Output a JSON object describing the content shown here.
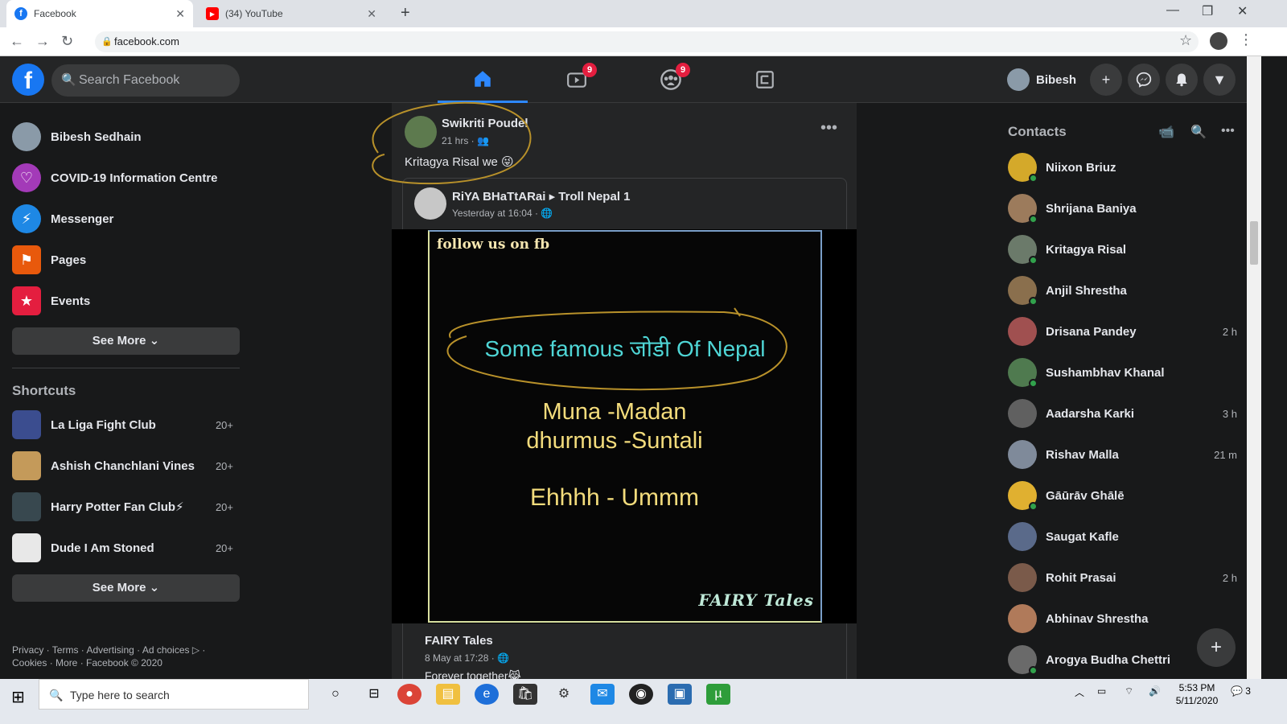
{
  "browser": {
    "tabs": [
      {
        "title": "Facebook",
        "icon": "facebook-favicon",
        "color": "#1877f2"
      },
      {
        "title": "(34) YouTube",
        "icon": "youtube-favicon",
        "color": "#ff0000"
      }
    ],
    "url": "facebook.com"
  },
  "header": {
    "search_placeholder": "Search Facebook",
    "nav": [
      {
        "icon": "home-icon",
        "badge": ""
      },
      {
        "icon": "watch-icon",
        "badge": "9"
      },
      {
        "icon": "groups-icon",
        "badge": "9"
      },
      {
        "icon": "gaming-icon",
        "badge": ""
      }
    ],
    "profile_name": "Bibesh",
    "accent": "#2d88ff"
  },
  "left_sidebar": {
    "items": [
      {
        "label": "Bibesh Sedhain",
        "icon": "profile-avatar",
        "color": "#8a9aa8"
      },
      {
        "label": "COVID-19 Information Centre",
        "icon": "covid-heart-icon",
        "color": "#a33ab8"
      },
      {
        "label": "Messenger",
        "icon": "messenger-icon",
        "color": "#1e88e5"
      },
      {
        "label": "Pages",
        "icon": "pages-flag-icon",
        "color": "#e8590c"
      },
      {
        "label": "Events",
        "icon": "events-calendar-icon",
        "color": "#e41e3f"
      }
    ],
    "see_more_1": "See More",
    "shortcuts_title": "Shortcuts",
    "shortcuts": [
      {
        "label": "La Liga Fight Club",
        "count": "20+",
        "color": "#3b4d8f"
      },
      {
        "label": "Ashish Chanchlani Vines",
        "count": "20+",
        "color": "#c49a5a"
      },
      {
        "label": "Harry Potter Fan Club⚡",
        "count": "20+",
        "color": "#38484f"
      },
      {
        "label": "Dude I Am Stoned",
        "count": "20+",
        "color": "#e8e8e8"
      }
    ],
    "see_more_2": "See More",
    "footer_line1": "Privacy · Terms · Advertising · Ad choices ▷ ·",
    "footer_line2": "Cookies · More · Facebook © 2020"
  },
  "post": {
    "author": "Swikriti Poudel",
    "time": "21 hrs ·",
    "text": "Kritagya Risal we 😜",
    "shared": {
      "author": "RiYA BHaTtARai",
      "target": "Troll Nepal 1",
      "time": "Yesterday at 16:04 ·"
    },
    "image": {
      "follow": "follow us on fb",
      "title": "Some famous जोडी Of Nepal",
      "line1": "Muna -Madan",
      "line2": "dhurmus -Suntali",
      "line3": "Ehhhh - Ummm",
      "signature": "FAIRY Tales"
    },
    "footer": {
      "name": "FAIRY Tales",
      "time": "8 May at 17:28 ·",
      "text": "Forever together😹"
    }
  },
  "contacts": {
    "title": "Contacts",
    "list": [
      {
        "name": "Niixon Briuz",
        "time": "",
        "online": true,
        "color": "#d4a92a"
      },
      {
        "name": "Shrijana Baniya",
        "time": "",
        "online": true,
        "color": "#9c7b5c"
      },
      {
        "name": "Kritagya Risal",
        "time": "",
        "online": true,
        "color": "#6b7a6a"
      },
      {
        "name": "Anjil Shrestha",
        "time": "",
        "online": true,
        "color": "#8a6f4d"
      },
      {
        "name": "Drisana Pandey",
        "time": "2 h",
        "online": false,
        "color": "#a05050"
      },
      {
        "name": "Sushambhav Khanal",
        "time": "",
        "online": true,
        "color": "#4f7a4f"
      },
      {
        "name": "Aadarsha Karki",
        "time": "3 h",
        "online": false,
        "color": "#606060"
      },
      {
        "name": "Rishav Malla",
        "time": "21 m",
        "online": false,
        "color": "#7f8a9a"
      },
      {
        "name": "Gāūrāv Ghālē",
        "time": "",
        "online": true,
        "color": "#e0b030"
      },
      {
        "name": "Saugat Kafle",
        "time": "",
        "online": false,
        "color": "#5a6a8a"
      },
      {
        "name": "Rohit Prasai",
        "time": "2 h",
        "online": false,
        "color": "#7a5a4a"
      },
      {
        "name": "Abhinav Shrestha",
        "time": "",
        "online": false,
        "color": "#b07a5a"
      },
      {
        "name": "Arogya Budha Chettri",
        "time": "",
        "online": true,
        "color": "#6a6a6a"
      }
    ]
  },
  "taskbar": {
    "search_placeholder": "Type here to search",
    "time": "5:53 PM",
    "date": "5/11/2020",
    "notifications": "3"
  }
}
